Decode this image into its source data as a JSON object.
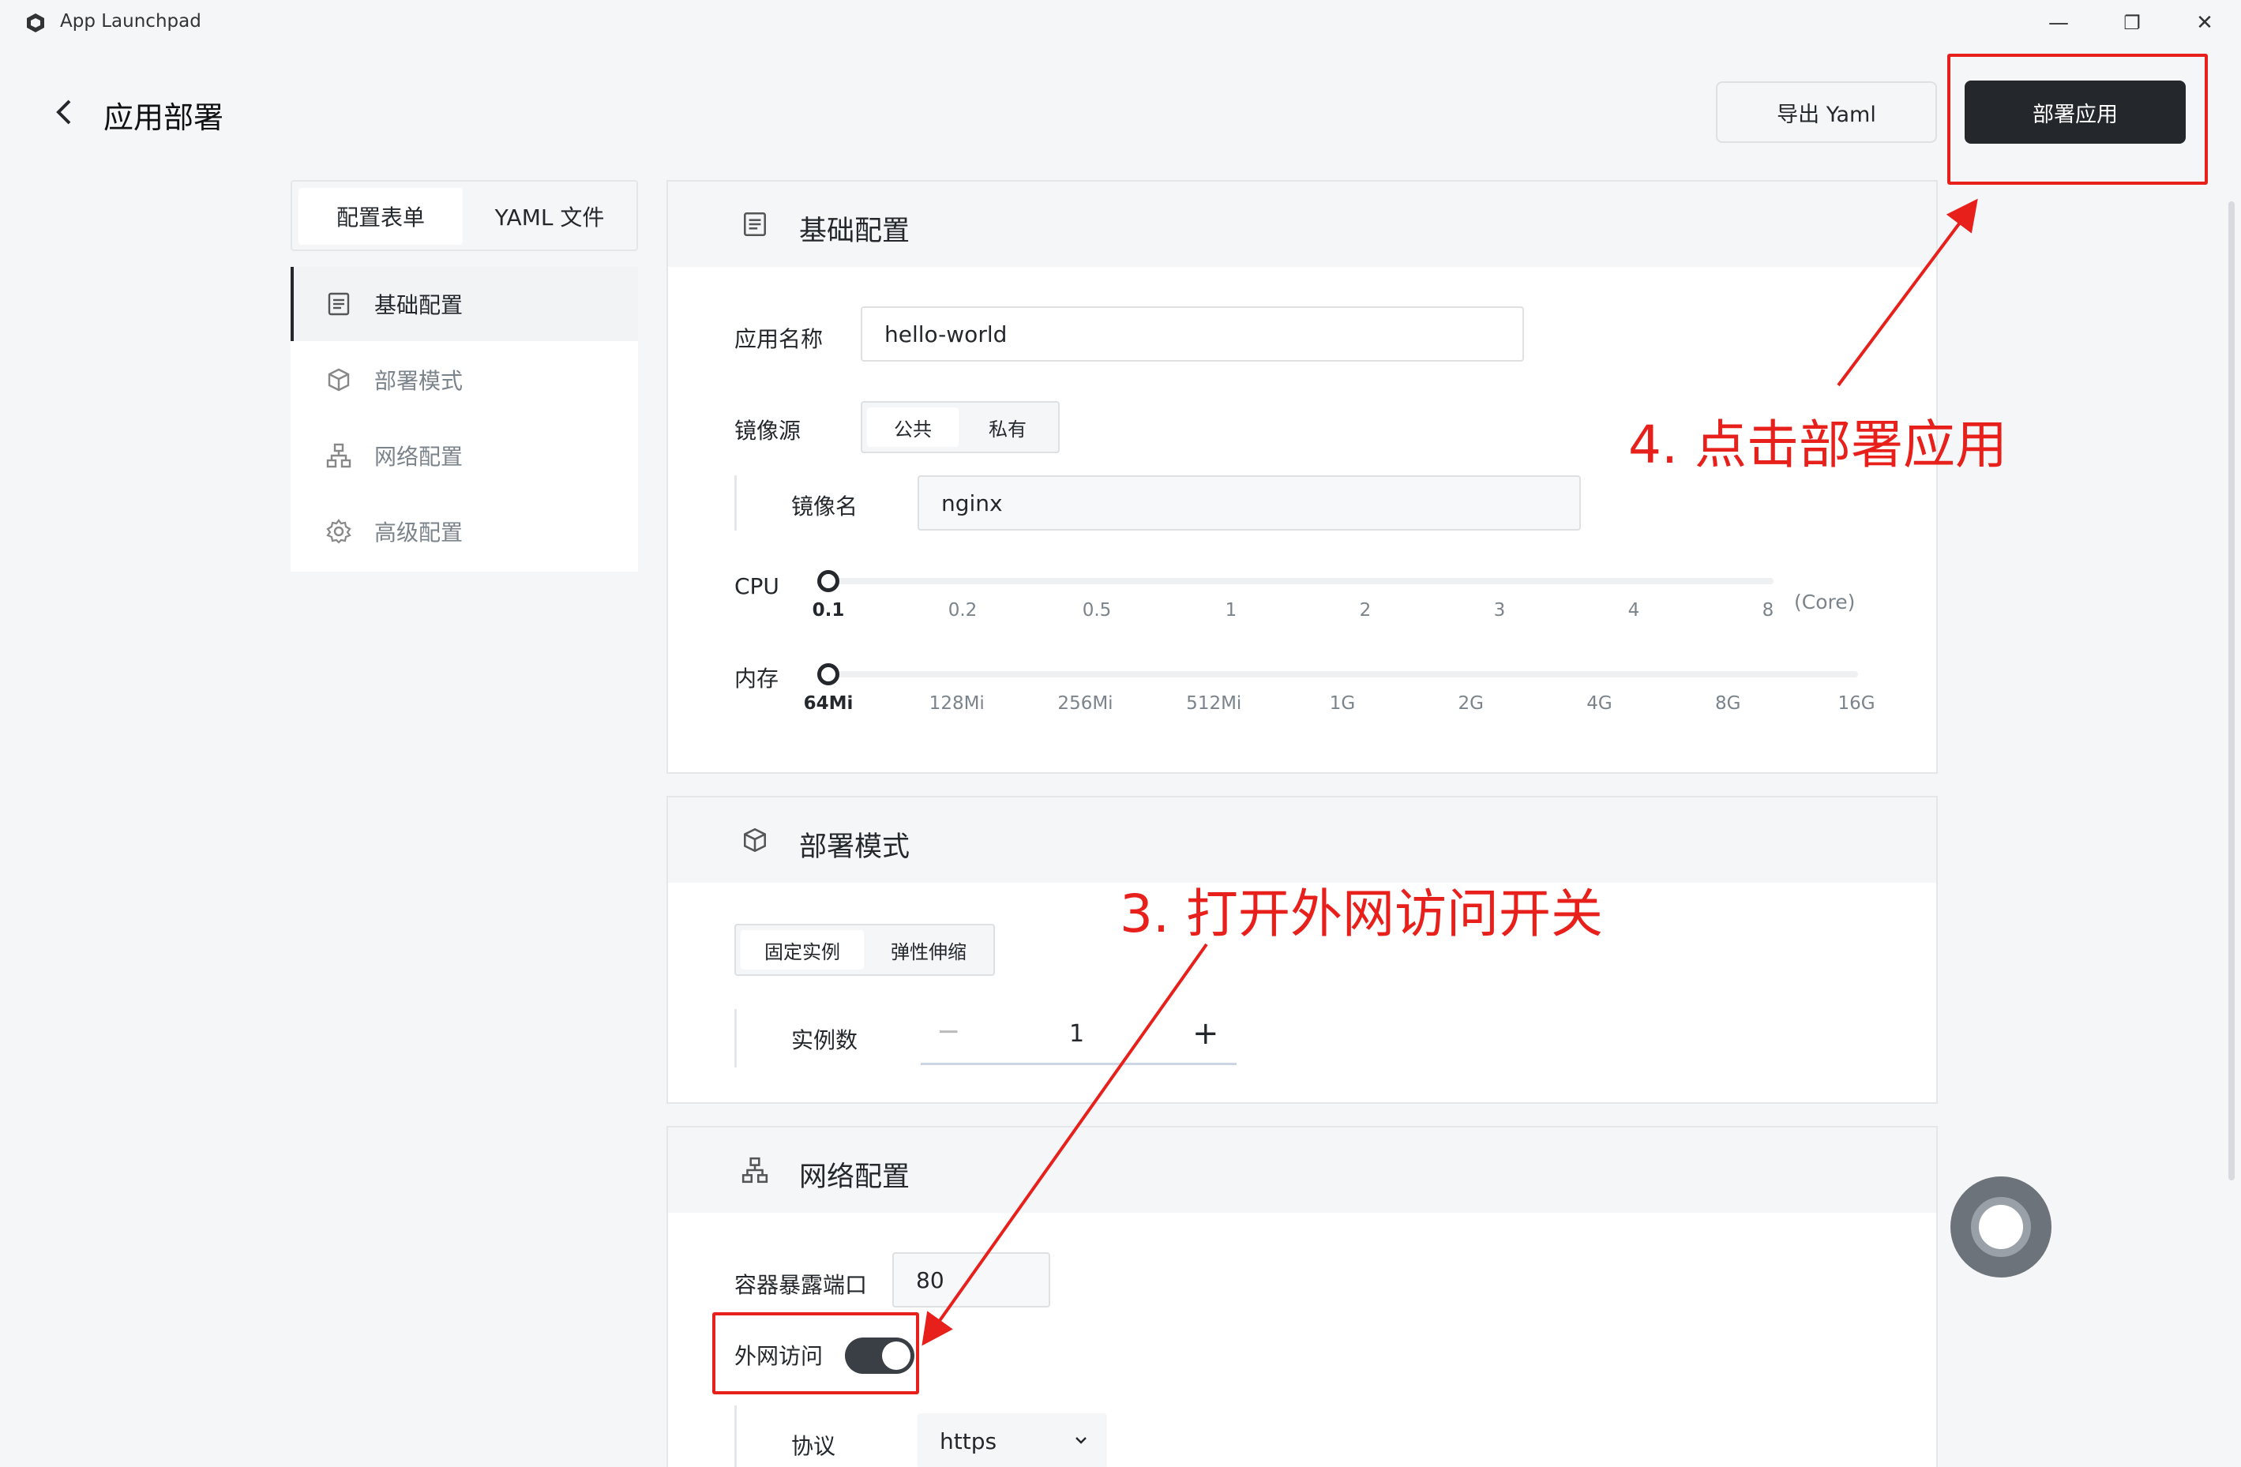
{
  "window": {
    "title": "App Launchpad",
    "controls": {
      "minimize": "—",
      "restore": "❐",
      "close": "✕"
    }
  },
  "header": {
    "title": "应用部署",
    "export_label": "导出 Yaml",
    "deploy_label": "部署应用"
  },
  "tabs": [
    {
      "label": "配置表单",
      "active": true
    },
    {
      "label": "YAML 文件",
      "active": false
    }
  ],
  "nav": [
    {
      "label": "基础配置",
      "icon": "document-icon",
      "active": true
    },
    {
      "label": "部署模式",
      "icon": "cube-icon",
      "active": false
    },
    {
      "label": "网络配置",
      "icon": "network-icon",
      "active": false
    },
    {
      "label": "高级配置",
      "icon": "gear-icon",
      "active": false
    }
  ],
  "basic": {
    "title": "基础配置",
    "app_name_label": "应用名称",
    "app_name_value": "hello-world",
    "image_source_label": "镜像源",
    "image_source_options": [
      "公共",
      "私有"
    ],
    "image_source_selected": "公共",
    "image_name_label": "镜像名",
    "image_name_value": "nginx",
    "cpu_label": "CPU",
    "cpu_ticks": [
      "0.1",
      "0.2",
      "0.5",
      "1",
      "2",
      "3",
      "4",
      "8"
    ],
    "cpu_selected": "0.1",
    "cpu_unit": "(Core)",
    "memory_label": "内存",
    "memory_ticks": [
      "64Mi",
      "128Mi",
      "256Mi",
      "512Mi",
      "1G",
      "2G",
      "4G",
      "8G",
      "16G"
    ],
    "memory_selected": "64Mi"
  },
  "deploy_mode": {
    "title": "部署模式",
    "options": [
      "固定实例",
      "弹性伸缩"
    ],
    "selected": "固定实例",
    "instances_label": "实例数",
    "instances_value": "1",
    "minus": "−",
    "plus": "+"
  },
  "network": {
    "title": "网络配置",
    "port_label": "容器暴露端口",
    "port_value": "80",
    "public_access_label": "外网访问",
    "public_access_on": true,
    "protocol_label": "协议",
    "protocol_value": "https"
  },
  "annotations": {
    "step3": "3. 打开外网访问开关",
    "step4": "4. 点击部署应用",
    "color": "#e8201c"
  },
  "colors": {
    "primary": "#24282c",
    "background": "#f4f6f8",
    "annotation": "#e8201c"
  }
}
